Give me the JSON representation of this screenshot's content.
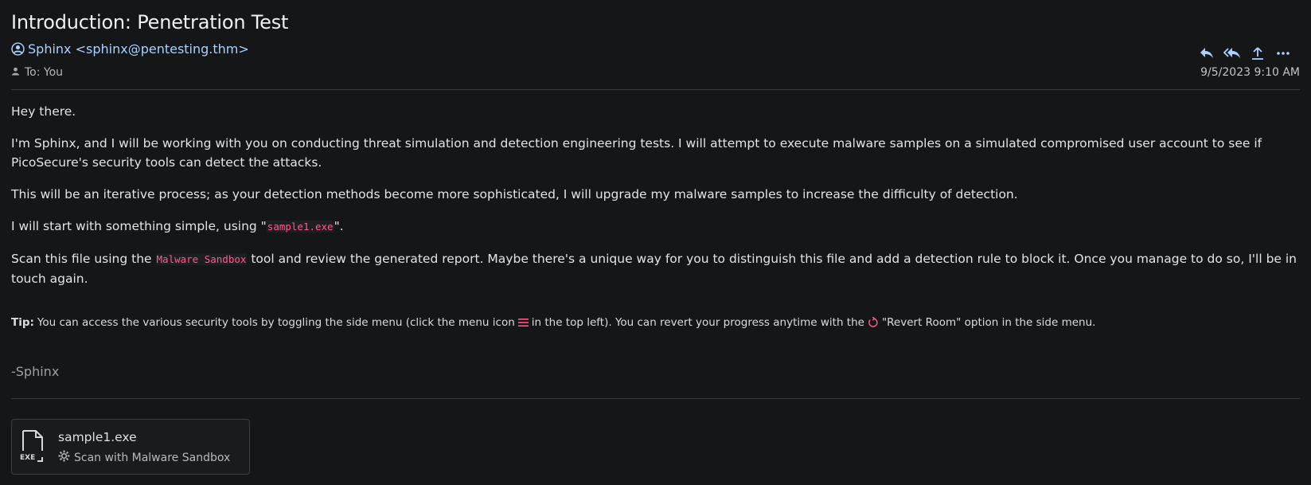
{
  "email": {
    "subject": "Introduction: Penetration Test",
    "from": "Sphinx <sphinx@pentesting.thm>",
    "to": "To: You",
    "date": "9/5/2023 9:10 AM",
    "actions": {
      "reply": "reply-icon",
      "reply_all": "reply-all-icon",
      "forward": "forward-icon",
      "more": "more-icon"
    },
    "body": {
      "greeting": "Hey there.",
      "p1": "I'm Sphinx, and I will be working with you on conducting threat simulation and detection engineering tests. I will attempt to execute malware samples on a simulated compromised user account to see if PicoSecure's security tools can detect the attacks.",
      "p2": "This will be an iterative process; as your detection methods become more sophisticated, I will upgrade my malware samples to increase the difficulty of detection.",
      "p3_pre": "I will start with something simple, using \"",
      "p3_code": "sample1.exe",
      "p3_post": "\".",
      "p4_pre": "Scan this file using the ",
      "p4_code": "Malware Sandbox",
      "p4_post": " tool and review the generated report. Maybe there's a unique way for you to distinguish this file and add a detection rule to block it. Once you manage to do so, I'll be in touch again."
    },
    "tip": {
      "label": "Tip:",
      "text_1": "You can access the various security tools by toggling the side menu (click the menu icon",
      "text_2": "in the top left). You can revert your progress anytime with the",
      "text_3": "\"Revert Room\" option in the side menu."
    },
    "signature": "-Sphinx",
    "attachment": {
      "filename": "sample1.exe",
      "action": "Scan with Malware Sandbox",
      "icon_label": "EXE"
    },
    "colors": {
      "link": "#a9d2ff",
      "code": "#ff5a8a",
      "background": "#151618"
    }
  }
}
